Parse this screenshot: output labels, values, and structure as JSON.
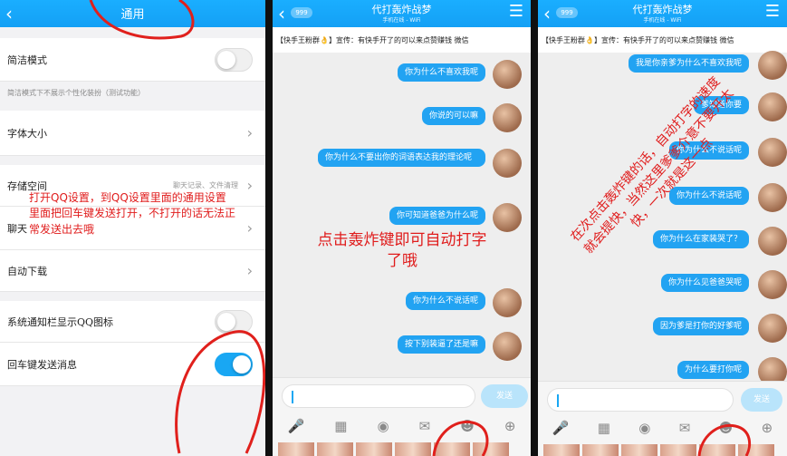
{
  "settings": {
    "title": "通用",
    "rows": [
      {
        "label": "简洁模式"
      },
      {
        "label": "字体大小"
      },
      {
        "label": "存储空间",
        "value": "聊天记录、文件清理"
      },
      {
        "label": "聊天"
      },
      {
        "label": "自动下载"
      },
      {
        "label": "系统通知栏显示QQ图标"
      },
      {
        "label": "回车键发送消息"
      }
    ],
    "simple_hint": "简洁模式下不展示个性化装扮（测试功能）",
    "annotation": "打开QQ设置，到QQ设置里面的通用设置里面把回车键发送打开，不打开的话无法正常发送出去哦"
  },
  "chat": {
    "name": "代打轰炸战梦",
    "subtitle": "手机在线 - WiFi",
    "badge": "999",
    "announcement": "【快手王粉群👌】宣传：有快手开了的可以来点赞赚钱 微信",
    "send_label": "发送",
    "icons": [
      "mic-icon",
      "image-icon",
      "camera-icon",
      "red-packet-icon",
      "emoji-icon",
      "plus-icon"
    ]
  },
  "chat_left": {
    "messages": [
      "你为什么不喜欢我呢",
      "你说的可以嘛",
      "你为什么不要出你的词语表达我的理论呢",
      "你可知道爸爸为什么呢",
      "你为什么不说话呢",
      "按下别装逼了还是嘛"
    ],
    "annotation": "点击轰炸键即可自动打字了哦"
  },
  "chat_right": {
    "messages": [
      "我是你亲爹为什么不喜欢我呢",
      "爹知道你要",
      "你为什么不说话呢",
      "你为什么不说话呢",
      "你为什么在家装哭了？",
      "你为什么见爸爸哭呢",
      "因为爹是打你的好爹呢",
      "为什么要打你呢"
    ],
    "annotation": "在次点击轰炸键的话，自动打字的速度就会提快，当然这里爹爹介意不要开太快，一次就是这一点"
  }
}
